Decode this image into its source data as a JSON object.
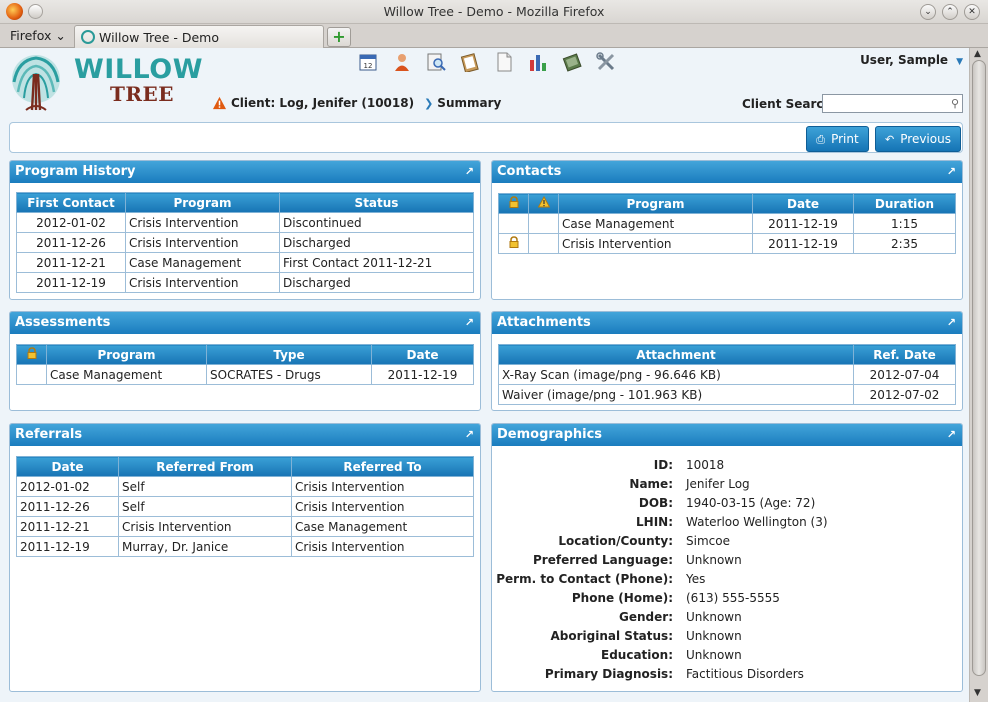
{
  "window": {
    "title": "Willow Tree - Demo - Mozilla Firefox"
  },
  "browser": {
    "menu_label": "Firefox",
    "tab_title": "Willow Tree - Demo",
    "new_tab_symbol": "+"
  },
  "logo": {
    "word1": "WILLOW",
    "word2": "TREE"
  },
  "toolbar": {
    "icons": [
      "calendar-icon",
      "client-icon",
      "search-doc-icon",
      "clipboard-icon",
      "document-icon",
      "reports-chart-icon",
      "book-icon",
      "tools-icon"
    ]
  },
  "user": {
    "name": "User, Sample"
  },
  "client": {
    "label": "Client: Log, Jenifer (10018)",
    "crumb": "Summary"
  },
  "search": {
    "label": "Client Search",
    "value": "",
    "placeholder": ""
  },
  "actions": {
    "print": "Print",
    "previous": "Previous"
  },
  "program_history": {
    "title": "Program History",
    "columns": [
      "First Contact",
      "Program",
      "Status"
    ],
    "rows": [
      [
        "2012-01-02",
        "Crisis Intervention",
        "Discontinued"
      ],
      [
        "2011-12-26",
        "Crisis Intervention",
        "Discharged"
      ],
      [
        "2011-12-21",
        "Case Management",
        "First Contact 2011-12-21"
      ],
      [
        "2011-12-19",
        "Crisis Intervention",
        "Discharged"
      ]
    ]
  },
  "contacts": {
    "title": "Contacts",
    "columns": [
      "Program",
      "Date",
      "Duration"
    ],
    "rows": [
      [
        "Case Management",
        "2011-12-19",
        "1:15"
      ],
      [
        "Crisis Intervention",
        "2011-12-19",
        "2:35"
      ]
    ]
  },
  "assessments": {
    "title": "Assessments",
    "columns": [
      "Program",
      "Type",
      "Date"
    ],
    "rows": [
      [
        "Case Management",
        "SOCRATES - Drugs",
        "2011-12-19"
      ]
    ]
  },
  "attachments": {
    "title": "Attachments",
    "columns": [
      "Attachment",
      "Ref. Date"
    ],
    "rows": [
      [
        "X-Ray Scan (image/png - 96.646 KB)",
        "2012-07-04"
      ],
      [
        "Waiver (image/png - 101.963 KB)",
        "2012-07-02"
      ]
    ]
  },
  "referrals": {
    "title": "Referrals",
    "columns": [
      "Date",
      "Referred From",
      "Referred To"
    ],
    "rows": [
      [
        "2012-01-02",
        "Self",
        "Crisis Intervention"
      ],
      [
        "2011-12-26",
        "Self",
        "Crisis Intervention"
      ],
      [
        "2011-12-21",
        "Crisis Intervention",
        "Case Management"
      ],
      [
        "2011-12-19",
        "Murray, Dr. Janice",
        "Crisis Intervention"
      ]
    ]
  },
  "demographics": {
    "title": "Demographics",
    "fields": [
      {
        "label": "ID:",
        "value": "10018"
      },
      {
        "label": "Name:",
        "value": "Jenifer Log"
      },
      {
        "label": "DOB:",
        "value": "1940-03-15 (Age: 72)"
      },
      {
        "label": "LHIN:",
        "value": "Waterloo Wellington (3)"
      },
      {
        "label": "Location/County:",
        "value": "Simcoe"
      },
      {
        "label": "Preferred Language:",
        "value": "Unknown"
      },
      {
        "label": "Perm. to Contact (Phone):",
        "value": "Yes"
      },
      {
        "label": "Phone (Home):",
        "value": "(613) 555-5555"
      },
      {
        "label": "Gender:",
        "value": "Unknown"
      },
      {
        "label": "Aboriginal Status:",
        "value": "Unknown"
      },
      {
        "label": "Education:",
        "value": "Unknown"
      },
      {
        "label": "Primary Diagnosis:",
        "value": "Factitious Disorders"
      }
    ]
  },
  "colors": {
    "header_blue": "#1a7cbe",
    "logo_teal": "#2a9ea0",
    "logo_brown": "#7a2c1e",
    "warning": "#e8a000"
  }
}
